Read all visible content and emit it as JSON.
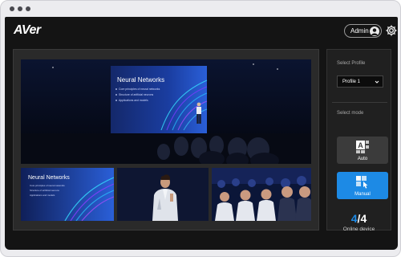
{
  "brand": {
    "logo_text": "AVer"
  },
  "header": {
    "user_label": "Admin"
  },
  "icons": {
    "user": "user-icon",
    "settings": "gear-icon",
    "auto": "auto-mode-icon",
    "manual": "manual-mode-icon"
  },
  "stage": {
    "slide_title": "Neural Networks",
    "slide_bullets": [
      "Core principles of neural networks",
      "Structure of artificial neurons",
      "Applications and models"
    ]
  },
  "thumbnails": [
    {
      "name": "slides",
      "title": "Neural Networks",
      "bullets": [
        "Core principles of neural networks",
        "Structure of artificial neurons",
        "Applications and models"
      ]
    },
    {
      "name": "presenter"
    },
    {
      "name": "audience"
    }
  ],
  "sidebar": {
    "profile_label": "Select Profile",
    "profile_value": "Profile 1",
    "mode_label": "Select mode",
    "modes": [
      {
        "label": "Auto",
        "active": false
      },
      {
        "label": "Manual",
        "active": true
      }
    ],
    "online_active": "4",
    "online_total": "4",
    "online_label": "Online device"
  },
  "colors": {
    "accent": "#1d8ae5",
    "background": "#141414",
    "panel": "#2a2a2a"
  }
}
